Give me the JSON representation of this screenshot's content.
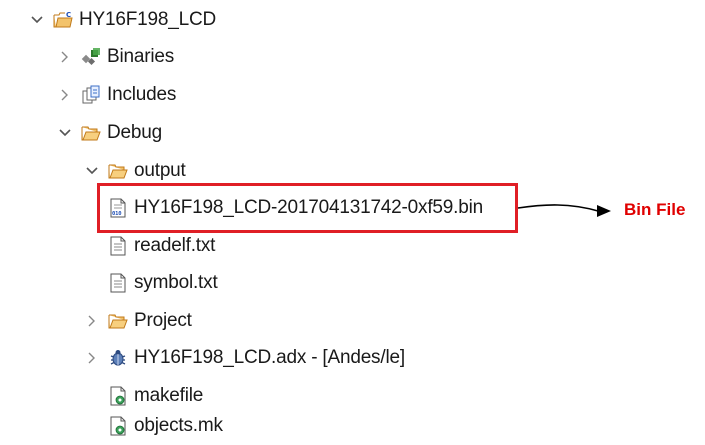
{
  "tree": {
    "project": {
      "label": "HY16F198_LCD",
      "icon": "c-project-folder-icon",
      "expanded": true
    },
    "binaries": {
      "label": "Binaries",
      "icon": "binaries-icon",
      "expanded": false
    },
    "includes": {
      "label": "Includes",
      "icon": "includes-icon",
      "expanded": false
    },
    "debug": {
      "label": "Debug",
      "icon": "folder-open-icon",
      "expanded": true
    },
    "output": {
      "label": "output",
      "icon": "folder-open-icon",
      "expanded": true
    },
    "bin_file": {
      "label": "HY16F198_LCD-201704131742-0xf59.bin",
      "icon": "binary-file-icon"
    },
    "readelf": {
      "label": "readelf.txt",
      "icon": "text-file-icon"
    },
    "symbol": {
      "label": "symbol.txt",
      "icon": "text-file-icon"
    },
    "project_folder": {
      "label": "Project",
      "icon": "folder-open-icon",
      "expanded": false
    },
    "adx": {
      "label": "HY16F198_LCD.adx - [Andes/le]",
      "icon": "debug-bug-icon",
      "expanded": false
    },
    "makefile": {
      "label": "makefile",
      "icon": "make-file-icon"
    },
    "objects_mk": {
      "label": "objects.mk",
      "icon": "make-file-icon"
    }
  },
  "annotation": {
    "label": "Bin File",
    "color": "#e00000",
    "box_color": "#e01f26"
  },
  "colors": {
    "folder": "#e8a33d",
    "folder_dark": "#c07a1a",
    "text": "#1a1a1a"
  }
}
